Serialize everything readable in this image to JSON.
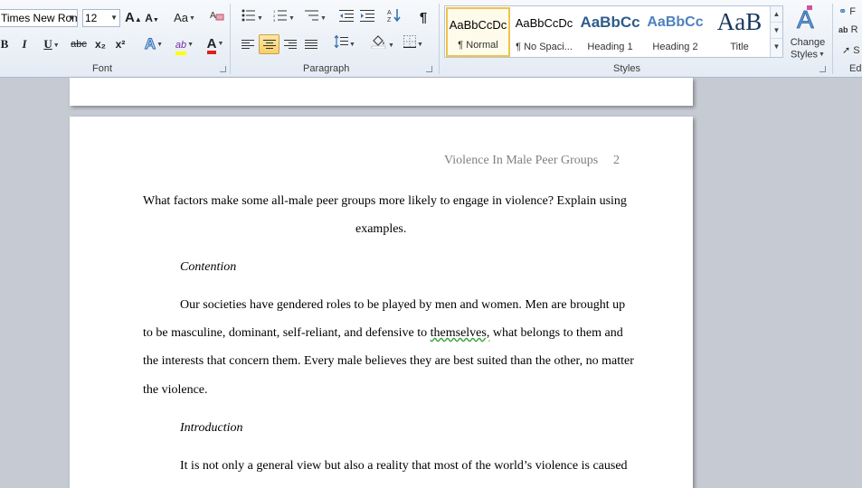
{
  "ribbon": {
    "font": {
      "font_name": "Times New Rom",
      "font_size": "12",
      "grow_label": "A",
      "shrink_label": "A",
      "change_case_label": "Aa",
      "bold": "B",
      "italic": "I",
      "underline": "U",
      "strikethrough": "abc",
      "subscript": "x₂",
      "superscript": "x²",
      "text_effects": "A",
      "highlight": "ab",
      "font_color": "A",
      "label": "Font"
    },
    "paragraph": {
      "pilcrow": "¶",
      "label": "Paragraph"
    },
    "styles": {
      "items": [
        {
          "preview": "AaBbCcDc",
          "name": "¶ Normal"
        },
        {
          "preview": "AaBbCcDc",
          "name": "¶ No Spaci..."
        },
        {
          "preview": "AaBbCc",
          "name": "Heading 1"
        },
        {
          "preview": "AaBbCc",
          "name": "Heading 2"
        },
        {
          "preview": "AaB",
          "name": "Title"
        }
      ],
      "change_styles_line1": "Change",
      "change_styles_line2": "Styles",
      "label": "Styles"
    },
    "editing": {
      "find": "F",
      "replace": "R",
      "select": "S",
      "label": "Ed"
    }
  },
  "document": {
    "header": {
      "running_head": "Violence In Male Peer Groups",
      "page_number": "2"
    },
    "lines": [
      "What factors make some all-male peer groups more likely to engage in violence? Explain using",
      "examples.",
      "Contention",
      "Our societies have gendered roles to be played by men and women. Men are brought up",
      "to be masculine, dominant, self-reliant, and defensive to",
      "themselves,",
      " what belongs to them and",
      "the interests that concern them. Every male believes they are best suited than the other, no matter",
      "the violence.",
      "Introduction",
      "It is not only a general view but also a reality that most of the world’s violence is caused"
    ]
  }
}
